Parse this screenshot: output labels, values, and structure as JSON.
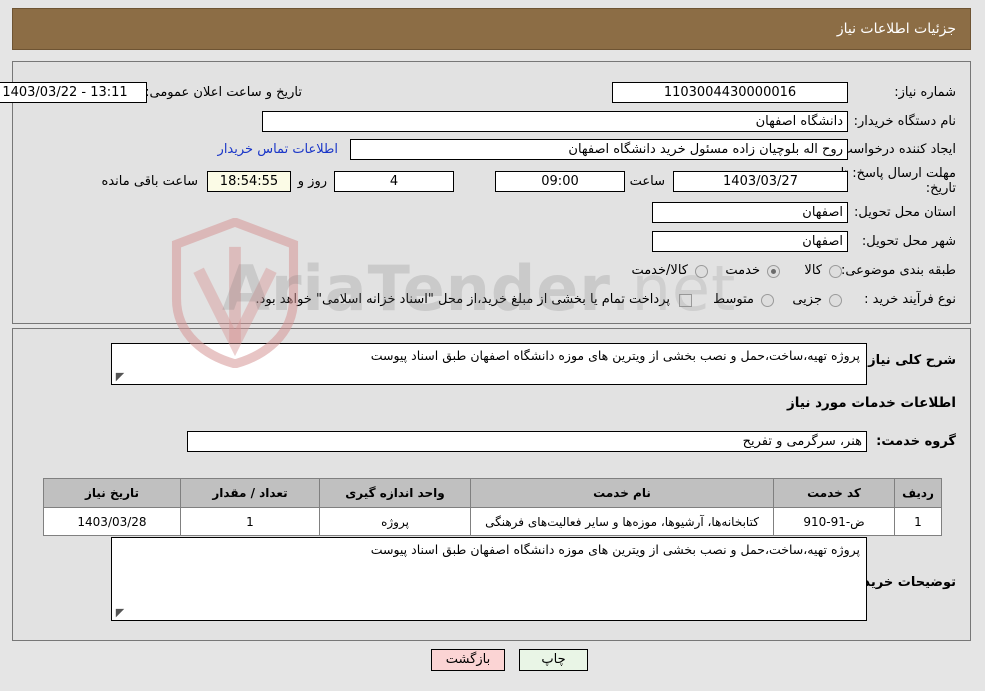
{
  "window": {
    "title": "جزئیات اطلاعات نیاز"
  },
  "colors": {
    "header_bg": "#8c6d45",
    "panel_bg": "#e2e2e2",
    "page_bg": "#e5e5e5",
    "link": "#1a36c8",
    "table_header_bg": "#c0c0c0",
    "countdown_bg": "#fbfbe6",
    "print_button_bg": "#e9f5e6",
    "back_button_bg": "#fbd4d4"
  },
  "watermark": {
    "text_main": "AriaTender",
    "text_suffix": ".net",
    "icon": "shield-icon"
  },
  "top_section": {
    "need_number": {
      "label": "شماره نیاز:",
      "value": "1103004430000016"
    },
    "announce_datetime": {
      "label": "تاریخ و ساعت اعلان عمومی:",
      "value": "13:11 - 1403/03/22"
    },
    "buyer_org": {
      "label": "نام دستگاه خریدار:",
      "value": "دانشگاه اصفهان"
    },
    "request_creator": {
      "label": "ایجاد کننده درخواست:",
      "value": "روح اله بلوچیان زاده مسئول خرید دانشگاه اصفهان"
    },
    "buyer_contact_link": "اطلاعات تماس خریدار",
    "response_deadline": {
      "label": "مهلت ارسال پاسخ: تا تاریخ:",
      "label_line1": "مهلت ارسال پاسخ: تا",
      "label_line2": "تاریخ:",
      "date": "1403/03/27",
      "time_label": "ساعت",
      "time": "09:00",
      "days": "4",
      "days_label": "روز و",
      "countdown": "18:54:55",
      "countdown_label": "ساعت باقی مانده"
    },
    "delivery_province": {
      "label": "استان محل تحویل:",
      "value": "اصفهان"
    },
    "delivery_city": {
      "label": "شهر محل تحویل:",
      "value": "اصفهان"
    },
    "category": {
      "label": "طبقه بندی موضوعی:",
      "options": [
        {
          "label": "کالا",
          "selected": false
        },
        {
          "label": "خدمت",
          "selected": true
        },
        {
          "label": "کالا/خدمت",
          "selected": false
        }
      ]
    },
    "purchase_process": {
      "label": "نوع فرآیند خرید :",
      "options": [
        {
          "label": "جزیی",
          "selected": false
        },
        {
          "label": "متوسط",
          "selected": false
        }
      ],
      "treasury_checkbox": {
        "checked": false,
        "text": "پرداخت تمام یا بخشی از مبلغ خرید،از محل \"اسناد خزانه اسلامی\" خواهد بود."
      }
    }
  },
  "middle_section": {
    "general_description": {
      "label": "شرح کلی نیاز:",
      "value": "پروژه تهیه،ساخت،حمل و نصب بخشی از ویترین های موزه دانشگاه اصفهان طبق اسناد پیوست"
    },
    "services_heading": "اطلاعات خدمات مورد نیاز",
    "service_group": {
      "label": "گروه خدمت:",
      "value": "هنر، سرگرمی و تفریح"
    },
    "table": {
      "headers": [
        "ردیف",
        "کد خدمت",
        "نام خدمت",
        "واحد اندازه گیری",
        "تعداد / مقدار",
        "تاریخ نیاز"
      ],
      "rows": [
        {
          "row_no": "1",
          "service_code": "ض-91-910",
          "service_name": "کتابخانه‌ها، آرشیوها، موزه‌ها و سایر فعالیت‌های فرهنگی",
          "unit": "پروژه",
          "quantity": "1",
          "need_date": "1403/03/28"
        }
      ]
    },
    "buyer_notes": {
      "label": "توضیحات خریدار:",
      "value": "پروژه تهیه،ساخت،حمل و نصب بخشی از ویترین های موزه دانشگاه اصفهان طبق اسناد پیوست"
    }
  },
  "footer": {
    "print_button": "چاپ",
    "back_button": "بازگشت"
  }
}
